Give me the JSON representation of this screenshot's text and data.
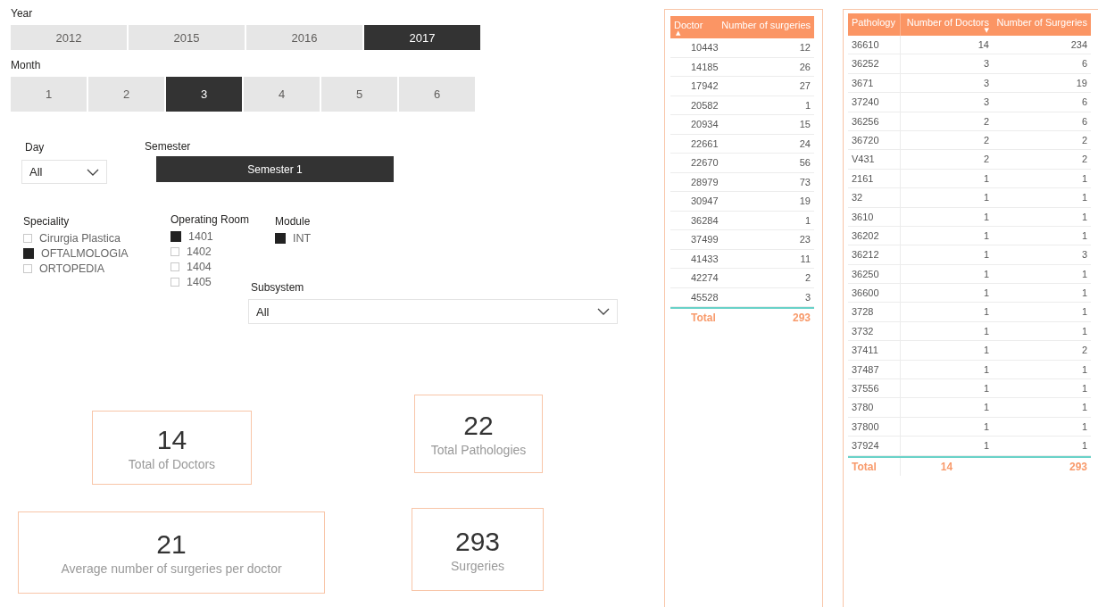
{
  "year_slicer": {
    "title": "Year",
    "options": [
      {
        "label": "2012",
        "selected": false
      },
      {
        "label": "2015",
        "selected": false
      },
      {
        "label": "2016",
        "selected": false
      },
      {
        "label": "2017",
        "selected": true
      }
    ]
  },
  "month_slicer": {
    "title": "Month",
    "options": [
      {
        "label": "1",
        "selected": false
      },
      {
        "label": "2",
        "selected": false
      },
      {
        "label": "3",
        "selected": true
      },
      {
        "label": "4",
        "selected": false
      },
      {
        "label": "5",
        "selected": false
      },
      {
        "label": "6",
        "selected": false
      }
    ]
  },
  "day_slicer": {
    "title": "Day",
    "value": "All"
  },
  "semester_slicer": {
    "title": "Semester",
    "options": [
      {
        "label": "Semester 1",
        "selected": true
      }
    ]
  },
  "speciality_slicer": {
    "title": "Speciality",
    "items": [
      {
        "label": "Cirurgia Plastica",
        "checked": false
      },
      {
        "label": "OFTALMOLOGIA",
        "checked": true
      },
      {
        "label": "ORTOPEDIA",
        "checked": false
      }
    ]
  },
  "operating_room_slicer": {
    "title": "Operating Room",
    "items": [
      {
        "label": "1401",
        "checked": true
      },
      {
        "label": "1402",
        "checked": false
      },
      {
        "label": "1404",
        "checked": false
      },
      {
        "label": "1405",
        "checked": false
      }
    ]
  },
  "module_slicer": {
    "title": "Module",
    "items": [
      {
        "label": "INT",
        "checked": true
      }
    ]
  },
  "subsystem_slicer": {
    "title": "Subsystem",
    "value": "All"
  },
  "cards": [
    {
      "value": "14",
      "label": "Total of Doctors"
    },
    {
      "value": "21",
      "label": "Average number of surgeries per doctor"
    },
    {
      "value": "22",
      "label": "Total Pathologies"
    },
    {
      "value": "293",
      "label": "Surgeries"
    }
  ],
  "doctor_table": {
    "columns": [
      {
        "label": "Doctor",
        "sort_arrow": "▲"
      },
      {
        "label": "Number of surgeries"
      }
    ],
    "rows": [
      [
        "10443",
        "12"
      ],
      [
        "14185",
        "26"
      ],
      [
        "17942",
        "27"
      ],
      [
        "20582",
        "1"
      ],
      [
        "20934",
        "15"
      ],
      [
        "22661",
        "24"
      ],
      [
        "22670",
        "56"
      ],
      [
        "28979",
        "73"
      ],
      [
        "30947",
        "19"
      ],
      [
        "36284",
        "1"
      ],
      [
        "37499",
        "23"
      ],
      [
        "41433",
        "11"
      ],
      [
        "42274",
        "2"
      ],
      [
        "45528",
        "3"
      ]
    ],
    "total": [
      "Total",
      "293"
    ]
  },
  "pathology_table": {
    "columns": [
      {
        "label": "Pathology"
      },
      {
        "label": "Number of Doctors",
        "sort_arrow": "▼"
      },
      {
        "label": "Number of Surgeries"
      }
    ],
    "rows": [
      [
        "36610",
        "14",
        "234"
      ],
      [
        "36252",
        "3",
        "6"
      ],
      [
        "3671",
        "3",
        "19"
      ],
      [
        "37240",
        "3",
        "6"
      ],
      [
        "36256",
        "2",
        "6"
      ],
      [
        "36720",
        "2",
        "2"
      ],
      [
        "V431",
        "2",
        "2"
      ],
      [
        "2161",
        "1",
        "1"
      ],
      [
        "32",
        "1",
        "1"
      ],
      [
        "3610",
        "1",
        "1"
      ],
      [
        "36202",
        "1",
        "1"
      ],
      [
        "36212",
        "1",
        "3"
      ],
      [
        "36250",
        "1",
        "1"
      ],
      [
        "36600",
        "1",
        "1"
      ],
      [
        "3728",
        "1",
        "1"
      ],
      [
        "3732",
        "1",
        "1"
      ],
      [
        "37411",
        "1",
        "2"
      ],
      [
        "37487",
        "1",
        "1"
      ],
      [
        "37556",
        "1",
        "1"
      ],
      [
        "3780",
        "1",
        "1"
      ],
      [
        "37800",
        "1",
        "1"
      ],
      [
        "37924",
        "1",
        "1"
      ]
    ],
    "total": [
      "Total",
      "14",
      "293"
    ]
  }
}
